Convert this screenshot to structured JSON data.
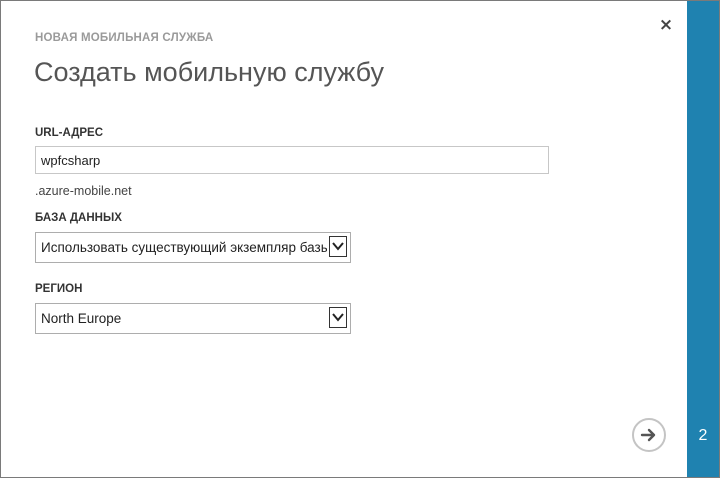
{
  "dialog": {
    "kicker": "НОВАЯ МОБИЛЬНАЯ СЛУЖБА",
    "title": "Создать мобильную службу",
    "close_label": "×"
  },
  "form": {
    "url": {
      "label": "URL-АДРЕС",
      "value": "wpfcsharp",
      "suffix": ".azure-mobile.net"
    },
    "database": {
      "label": "БАЗА ДАННЫХ",
      "selected": "Использовать существующий экземпляр базы данных SQL"
    },
    "region": {
      "label": "РЕГИОН",
      "selected": "North Europe"
    }
  },
  "wizard": {
    "step": "2"
  },
  "icons": {
    "close": "close-icon",
    "next": "arrow-right-icon",
    "dropdown": "chevron-down-icon"
  },
  "colors": {
    "accent": "#1f82b0",
    "kicker": "#9a9a9a",
    "title": "#555555"
  }
}
